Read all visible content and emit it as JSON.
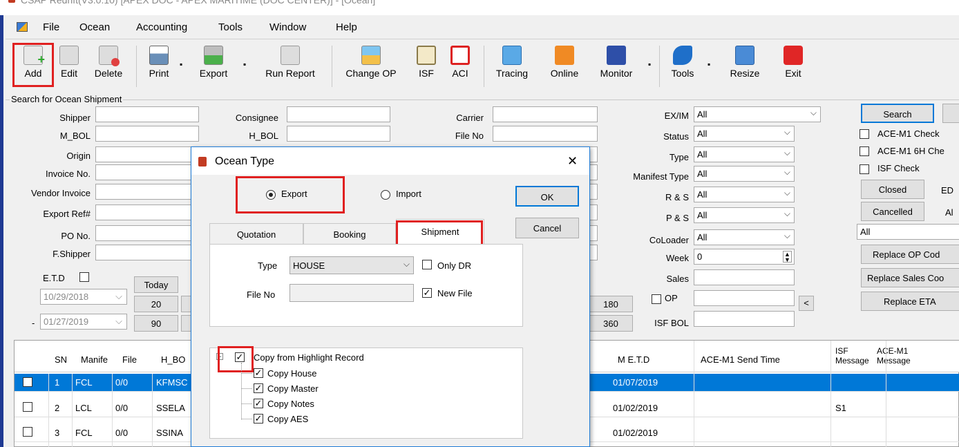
{
  "window": {
    "title": "CSAP Redrift(V3.0.10) [APEX DOC - APEX MARITIME (DOC CENTER)] - [Ocean]"
  },
  "menu": [
    "File",
    "Ocean",
    "Accounting",
    "Tools",
    "Window",
    "Help"
  ],
  "toolbar": {
    "add": "Add",
    "edit": "Edit",
    "delete": "Delete",
    "print": "Print",
    "export": "Export",
    "run_report": "Run Report",
    "change_op": "Change OP",
    "isf": "ISF",
    "aci": "ACI",
    "tracing": "Tracing",
    "online": "Online",
    "monitor": "Monitor",
    "tools": "Tools",
    "resize": "Resize",
    "exit": "Exit"
  },
  "search": {
    "group_title": "Search for Ocean Shipment",
    "left_labels": [
      "Shipper",
      "M_BOL",
      "Origin",
      "Invoice No.",
      "Vendor Invoice",
      "Export Ref#",
      "PO No.",
      "F.Shipper"
    ],
    "mid_labels": [
      "Consignee",
      "H_BOL"
    ],
    "right_labels": [
      "Carrier",
      "File No"
    ],
    "etd_label": "E.T.D",
    "today_label": "Today",
    "date_from": "10/29/2018",
    "date_to": "01/27/2019",
    "dash": "-",
    "day_btns": [
      "20",
      "90"
    ],
    "day_btns_right": [
      "180",
      "360"
    ],
    "exim_label": "EX/IM",
    "exim_value": "All",
    "status_label": "Status",
    "status_value": "All",
    "type_label": "Type",
    "type_value": "All",
    "manifest_label": "Manifest Type",
    "manifest_value": "All",
    "rs_label": "R & S",
    "rs_value": "All",
    "ps_label": "P & S",
    "ps_value": "All",
    "coloader_label": "CoLoader",
    "coloader_value": "All",
    "week_label": "Week",
    "week_value": "0",
    "sales_label": "Sales",
    "op_label": "OP",
    "isf_bol_label": "ISF BOL",
    "search_btn": "Search",
    "ace_m1_check": "ACE-M1 Check",
    "ace_m1_6h": "ACE-M1 6H Che",
    "isf_check": "ISF Check",
    "closed_btn": "Closed",
    "ed_label": "ED",
    "cancelled_btn": "Cancelled",
    "al_label": "Al",
    "all_select": "All",
    "replace_op": "Replace OP Cod",
    "replace_sales": "Replace Sales Coo",
    "replace_eta": "Replace ETA"
  },
  "grid": {
    "headers": [
      "SN",
      "Manife",
      "File",
      "H_BO",
      "M E.T.D",
      "ACE-M1 Send Time",
      "ISF Message",
      "ACE-M1 Message"
    ],
    "isf_header_line1": "ISF",
    "isf_header_line2": "Message",
    "ace_header_line1": "ACE-M1",
    "ace_header_line2": "Message",
    "rows": [
      {
        "sn": "1",
        "manifest": "FCL",
        "file": "0/0",
        "hbol": "KFMSC",
        "metd": "01/07/2019",
        "isf": ""
      },
      {
        "sn": "2",
        "manifest": "LCL",
        "file": "0/0",
        "hbol": "SSELA",
        "metd": "01/02/2019",
        "isf": "S1"
      },
      {
        "sn": "3",
        "manifest": "FCL",
        "file": "0/0",
        "hbol": "SSINA",
        "metd": "01/02/2019",
        "isf": ""
      }
    ]
  },
  "dialog": {
    "title": "Ocean Type",
    "close": "✕",
    "radio_export": "Export",
    "radio_import": "Import",
    "ok": "OK",
    "cancel": "Cancel",
    "tabs": [
      "Quotation",
      "Booking",
      "Shipment"
    ],
    "type_label": "Type",
    "type_value": "HOUSE",
    "only_dr": "Only DR",
    "file_no_label": "File No",
    "new_file": "New File",
    "tree_root": "Copy from Highlight Record",
    "tree_items": [
      "Copy House",
      "Copy Master",
      "Copy Notes",
      "Copy AES"
    ]
  },
  "colors": {
    "selection": "#0078d7",
    "highlight_red": "#e02020",
    "dialog_border": "#1e7bd6"
  }
}
